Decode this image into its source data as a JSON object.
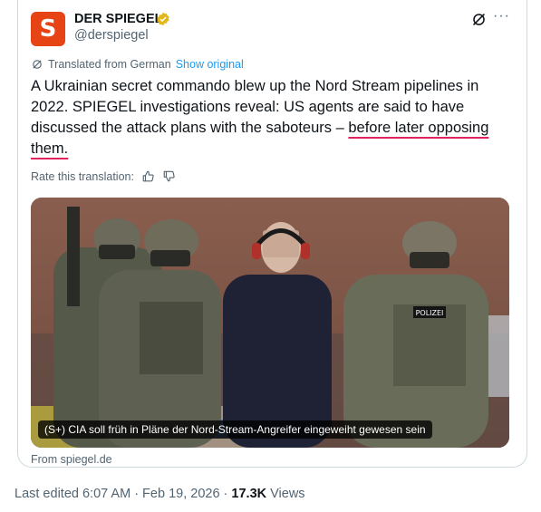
{
  "account": {
    "avatar_letter": "S",
    "name": "DER SPIEGEL",
    "handle": "@derspiegel",
    "brand_color": "#e64415",
    "verified_color": "#e2b719"
  },
  "translation": {
    "label": "Translated from German",
    "show_original": "Show original"
  },
  "tweet": {
    "text_plain": "A Ukrainian secret commando blew up the Nord Stream pipelines in 2022. SPIEGEL investigations reveal: US agents are said to have discussed the attack plans with the saboteurs – ",
    "text_underlined": "before later opposing them."
  },
  "rating": {
    "label": "Rate this translation:",
    "thumbs_up": "thumbs-up-icon",
    "thumbs_down": "thumbs-down-icon"
  },
  "media": {
    "caption": "(S+) CIA soll früh in Pläne der Nord-Stream-Angreifer eingeweiht gewesen sein",
    "vest_label": "POLIZEI",
    "source": "From spiegel.de"
  },
  "meta": {
    "edited": "Last edited 6:07 AM · Feb 19, 2026 · ",
    "views_count": "17.3K",
    "views_label": " Views"
  }
}
